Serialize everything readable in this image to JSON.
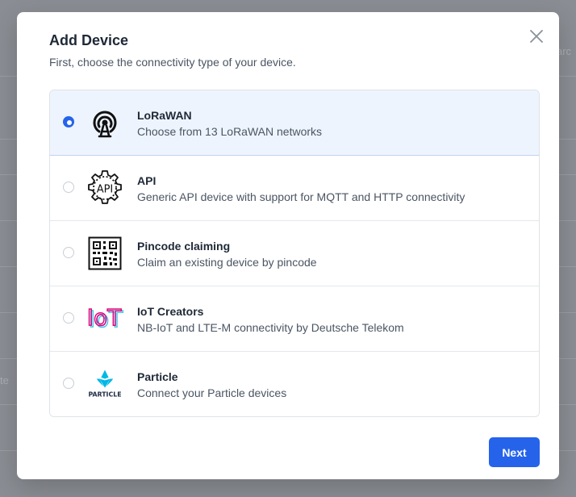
{
  "background": {
    "search_fragment": "arc",
    "side_fragment": "te"
  },
  "modal": {
    "title": "Add Device",
    "subtitle": "First, choose the connectivity type of your device.",
    "options": [
      {
        "title": "LoRaWAN",
        "description": "Choose from 13 LoRaWAN networks",
        "icon": "radio-tower-icon",
        "selected": true
      },
      {
        "title": "API",
        "description": "Generic API device with support for MQTT and HTTP connectivity",
        "icon": "api-gear-icon",
        "selected": false
      },
      {
        "title": "Pincode claiming",
        "description": "Claim an existing device by pincode",
        "icon": "qr-code-icon",
        "selected": false
      },
      {
        "title": "IoT Creators",
        "description": "NB-IoT and LTE-M connectivity by Deutsche Telekom",
        "icon": "iot-creators-logo",
        "logo_text": "IoT",
        "selected": false
      },
      {
        "title": "Particle",
        "description": "Connect your Particle devices",
        "icon": "particle-logo",
        "logo_text": "PARTICLE",
        "selected": false
      }
    ],
    "next_label": "Next"
  },
  "colors": {
    "accent": "#2563eb",
    "selected_bg": "#eef4fd",
    "particle_cyan": "#00b8e6",
    "iot_cyan": "#48c3e8",
    "iot_magenta": "#e2007a"
  }
}
